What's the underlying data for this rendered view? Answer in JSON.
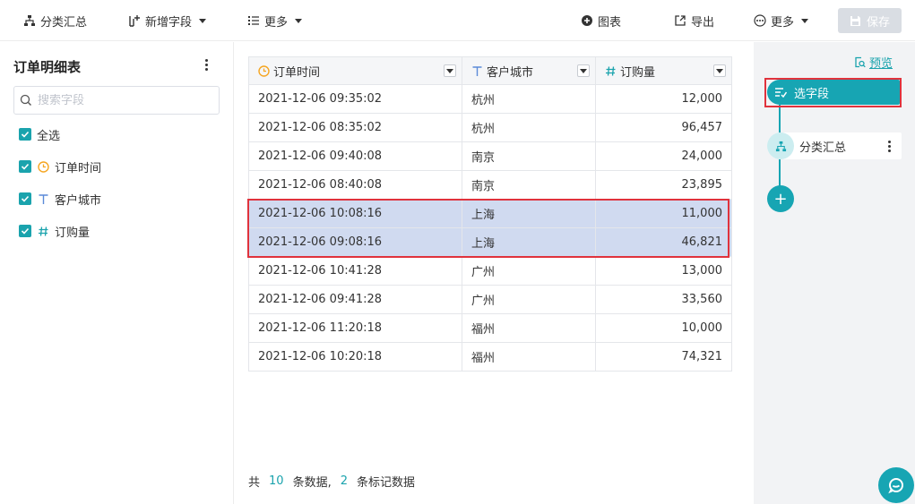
{
  "toolbar": {
    "group_summary": "分类汇总",
    "add_field": "新增字段",
    "more_left": "更多",
    "chart": "图表",
    "export": "导出",
    "more_right": "更多",
    "save": "保存"
  },
  "left_panel": {
    "title": "订单明细表",
    "search_placeholder": "搜索字段",
    "select_all": "全选",
    "fields": [
      {
        "label": "订单时间",
        "type": "date"
      },
      {
        "label": "客户城市",
        "type": "text"
      },
      {
        "label": "订购量",
        "type": "number"
      }
    ]
  },
  "table": {
    "columns": [
      "订单时间",
      "客户城市",
      "订购量"
    ],
    "rows": [
      [
        "2021-12-06 09:35:02",
        "杭州",
        "12,000"
      ],
      [
        "2021-12-06 08:35:02",
        "杭州",
        "96,457"
      ],
      [
        "2021-12-06 09:40:08",
        "南京",
        "24,000"
      ],
      [
        "2021-12-06 08:40:08",
        "南京",
        "23,895"
      ],
      [
        "2021-12-06 10:08:16",
        "上海",
        "11,000"
      ],
      [
        "2021-12-06 09:08:16",
        "上海",
        "46,821"
      ],
      [
        "2021-12-06 10:41:28",
        "广州",
        "13,000"
      ],
      [
        "2021-12-06 09:41:28",
        "广州",
        "33,560"
      ],
      [
        "2021-12-06 11:20:18",
        "福州",
        "10,000"
      ],
      [
        "2021-12-06 10:20:18",
        "福州",
        "74,321"
      ]
    ],
    "marked_rows": [
      4,
      5
    ]
  },
  "footer": {
    "prefix": "共",
    "total": "10",
    "mid": "条数据,",
    "marked": "2",
    "suffix": "条标记数据"
  },
  "right_panel": {
    "preview": "预览",
    "steps": [
      {
        "label": "选字段",
        "active": true
      },
      {
        "label": "分类汇总",
        "active": false
      }
    ],
    "add": "+"
  },
  "colors": {
    "accent": "#17a5b3",
    "marked_row": "#d0daf0",
    "highlight_border": "#e0323c"
  }
}
